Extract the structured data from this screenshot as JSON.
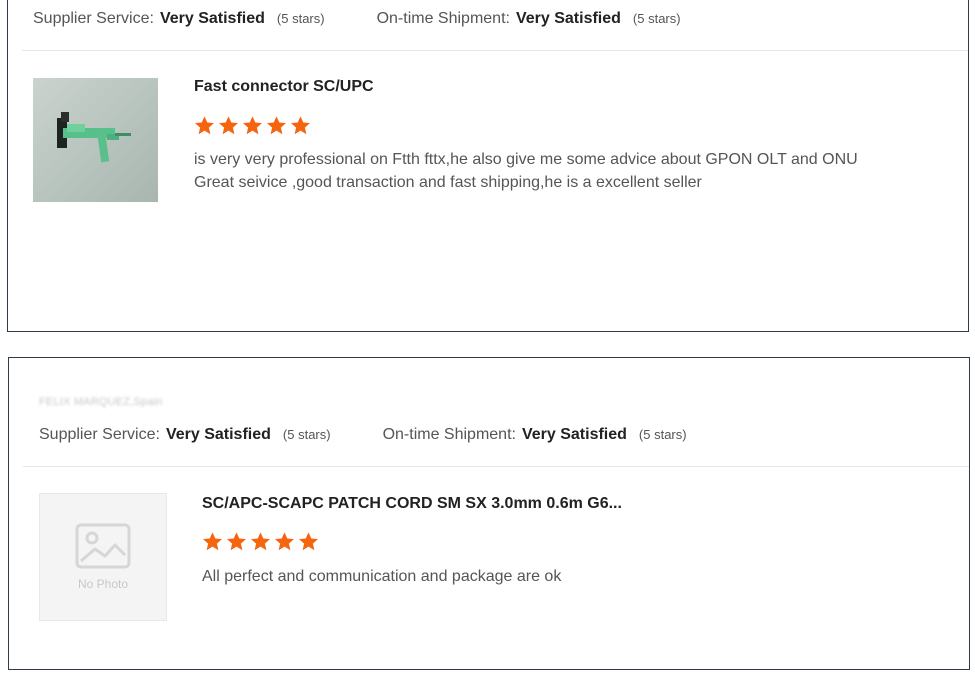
{
  "reviews": [
    {
      "supplier_service_label": "Supplier Service:",
      "supplier_service_value": "Very Satisfied",
      "supplier_service_stars": "(5 stars)",
      "shipment_label": "On-time Shipment:",
      "shipment_value": "Very Satisfied",
      "shipment_stars": "(5 stars)",
      "product_title": "Fast connector SC/UPC",
      "star_rating": 5,
      "review_lines": [
        "is very very professional on Ftth fttx,he also give me some advice about GPON OLT and ONU",
        "Great seivice ,good transaction and fast shipping,he is a excellent seller"
      ]
    },
    {
      "reviewer": "FELIX MARQUEZ,Spain",
      "supplier_service_label": "Supplier Service:",
      "supplier_service_value": "Very Satisfied",
      "supplier_service_stars": "(5 stars)",
      "shipment_label": "On-time Shipment:",
      "shipment_value": "Very Satisfied",
      "shipment_stars": "(5 stars)",
      "product_title": "SC/APC-SCAPC PATCH CORD SM SX 3.0mm 0.6m G6...",
      "star_rating": 5,
      "no_photo_label": "No Photo",
      "review_lines": [
        "All perfect and communication and package are ok"
      ]
    }
  ],
  "colors": {
    "star": "#f5640f",
    "border": "#2f3b48",
    "divider": "#e6e6e6"
  },
  "icons": {
    "star": "star-icon",
    "no_photo": "image-placeholder-icon"
  }
}
